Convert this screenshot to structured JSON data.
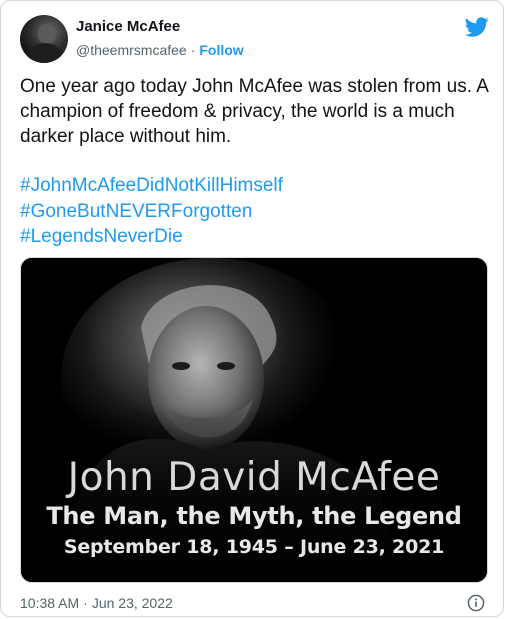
{
  "author": {
    "name": "Janice McAfee",
    "handle": "@theemrsmcafee",
    "separator": "·",
    "follow_label": "Follow"
  },
  "tweet": {
    "text": "One year ago today John McAfee was stolen from us. A champion of freedom & privacy, the world is a much darker place without him.",
    "hashtags": [
      "#JohnMcAfeeDidNotKillHimself",
      "#GoneButNEVERForgotten",
      "#LegendsNeverDie"
    ]
  },
  "media": {
    "title": "John David McAfee",
    "subtitle": "The Man, the Myth, the Legend",
    "dates": "September 18, 1945 – June 23, 2021"
  },
  "footer": {
    "time": "10:38 AM",
    "separator": "·",
    "date": "Jun 23, 2022"
  },
  "icons": {
    "brand": "twitter-bird-icon",
    "info": "info-icon"
  },
  "colors": {
    "accent": "#1d9bf0",
    "text": "#0f1419",
    "muted": "#536471",
    "border": "#cfd9de"
  }
}
